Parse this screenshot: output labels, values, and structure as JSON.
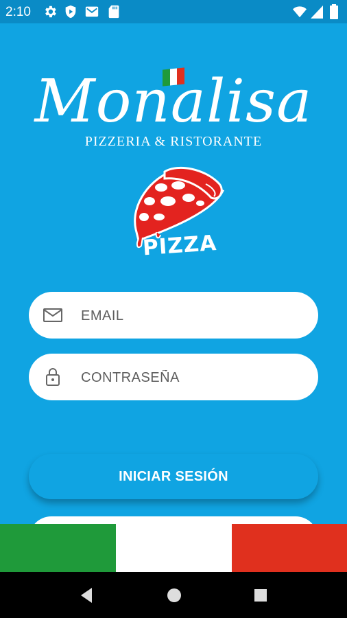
{
  "status_bar": {
    "time": "2:10",
    "left_icons": [
      "settings-icon",
      "shield-play-icon",
      "gmail-icon",
      "sd-card-icon"
    ],
    "right_icons": [
      "wifi-icon",
      "signal-icon",
      "battery-icon"
    ]
  },
  "brand": {
    "name": "Monalisa",
    "tagline": "PIZZERIA & RISTORANTE",
    "flag_colors": [
      "#1f9a3a",
      "#ffffff",
      "#e0301e"
    ]
  },
  "pizza_logo": {
    "text": "PIZZA",
    "colors": {
      "crust": "#e3231f",
      "pepperoni": "#ffffff",
      "outline": "#ffffff"
    }
  },
  "form": {
    "email": {
      "placeholder": "EMAIL",
      "value": "",
      "icon": "mail-icon"
    },
    "password": {
      "placeholder": "CONTRASEÑA",
      "value": "",
      "icon": "lock-icon"
    },
    "login_label": "INICIAR SESIÓN"
  },
  "footer_band": {
    "colors": [
      "#1f9a3a",
      "#ffffff",
      "#e0301e"
    ]
  },
  "nav_bar": {
    "buttons": [
      "back-icon",
      "home-icon",
      "recents-icon"
    ]
  },
  "theme": {
    "background": "#10a4e2",
    "status_bar": "#0a8bc6"
  }
}
